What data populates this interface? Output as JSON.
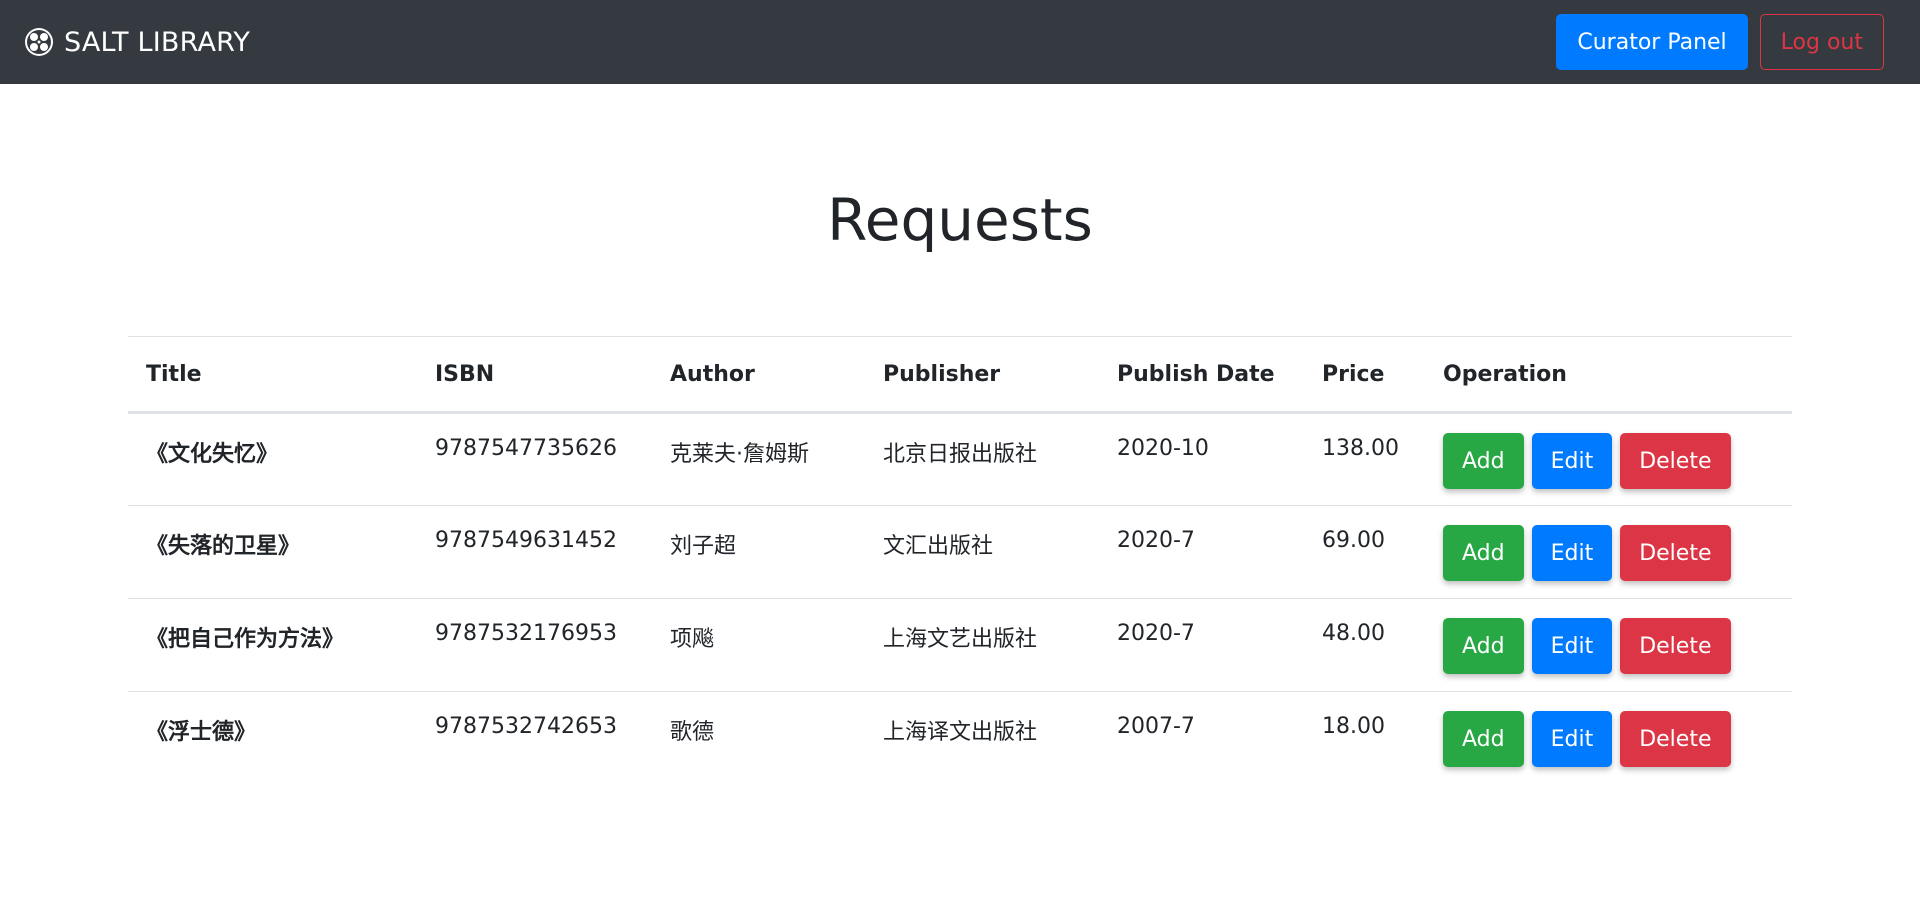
{
  "navbar": {
    "brand": "SALT LIBRARY",
    "curator_label": "Curator Panel",
    "logout_label": "Log out"
  },
  "page": {
    "title": "Requests"
  },
  "table": {
    "headers": {
      "title": "Title",
      "isbn": "ISBN",
      "author": "Author",
      "publisher": "Publisher",
      "publish_date": "Publish Date",
      "price": "Price",
      "operation": "Operation"
    },
    "rows": [
      {
        "title": "《文化失忆》",
        "isbn": "9787547735626",
        "author": "克莱夫·詹姆斯",
        "publisher": "北京日报出版社",
        "publish_date": "2020-10",
        "price": "138.00"
      },
      {
        "title": "《失落的卫星》",
        "isbn": "9787549631452",
        "author": "刘子超",
        "publisher": "文汇出版社",
        "publish_date": "2020-7",
        "price": "69.00"
      },
      {
        "title": "《把自己作为方法》",
        "isbn": "9787532176953",
        "author": "项飚",
        "publisher": "上海文艺出版社",
        "publish_date": "2020-7",
        "price": "48.00"
      },
      {
        "title": "《浮士德》",
        "isbn": "9787532742653",
        "author": "歌德",
        "publisher": "上海译文出版社",
        "publish_date": "2007-7",
        "price": "18.00"
      }
    ],
    "ops": {
      "add": "Add",
      "edit": "Edit",
      "delete": "Delete"
    }
  },
  "colors": {
    "navbar_bg": "#343a40",
    "primary": "#007bff",
    "success": "#28a745",
    "danger": "#dc3545"
  },
  "icons": {
    "brand": "film-reel-icon"
  }
}
